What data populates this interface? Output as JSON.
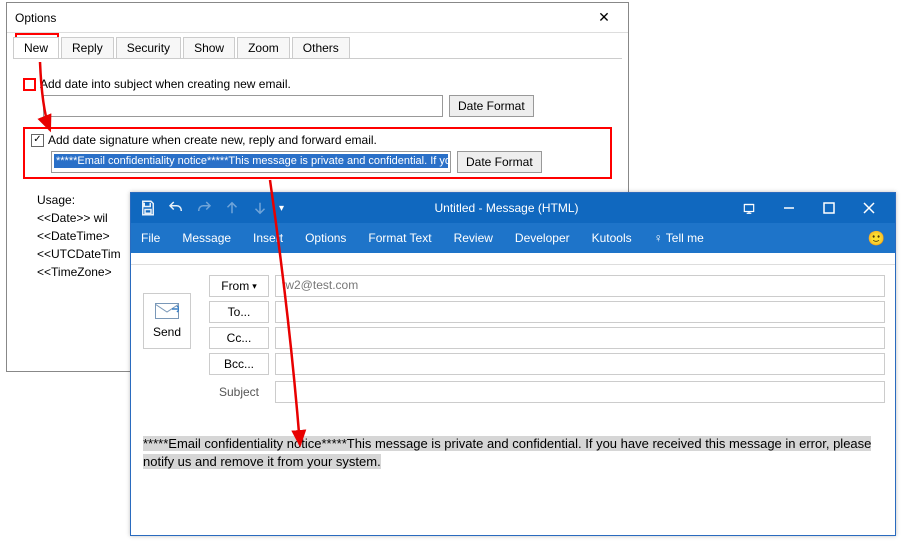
{
  "options": {
    "title": "Options",
    "tabs": [
      "New",
      "Reply",
      "Security",
      "Show",
      "Zoom",
      "Others"
    ],
    "active_tab": "New",
    "row1": {
      "checkbox_checked": false,
      "label": "Add date into subject when creating new email.",
      "input_value": "",
      "button": "Date Format"
    },
    "row2": {
      "checkbox_checked": true,
      "label": "Add date signature when create new, reply and forward email.",
      "input_value": "*****Email confidentiality notice*****This message is private and confidential. If yo",
      "button": "Date Format"
    },
    "usage": {
      "heading": "Usage:",
      "lines": [
        "<<Date>> wil",
        "<<DateTime>",
        "<<UTCDateTim",
        "<<TimeZone>"
      ]
    }
  },
  "message": {
    "titlebar": {
      "title": "Untitled  -  Message (HTML)"
    },
    "ribbon_tabs": [
      "File",
      "Message",
      "Insert",
      "Options",
      "Format Text",
      "Review",
      "Developer",
      "Kutools"
    ],
    "tell_me": "Tell me",
    "send_label": "Send",
    "fields": {
      "from_label": "From",
      "from_value": "tw2@test.com",
      "to_label": "To...",
      "cc_label": "Cc...",
      "bcc_label": "Bcc...",
      "subject_label": "Subject"
    },
    "body_text": "*****Email confidentiality notice*****This message is private and confidential. If you have received this message in error, please notify us and remove it from your system."
  }
}
